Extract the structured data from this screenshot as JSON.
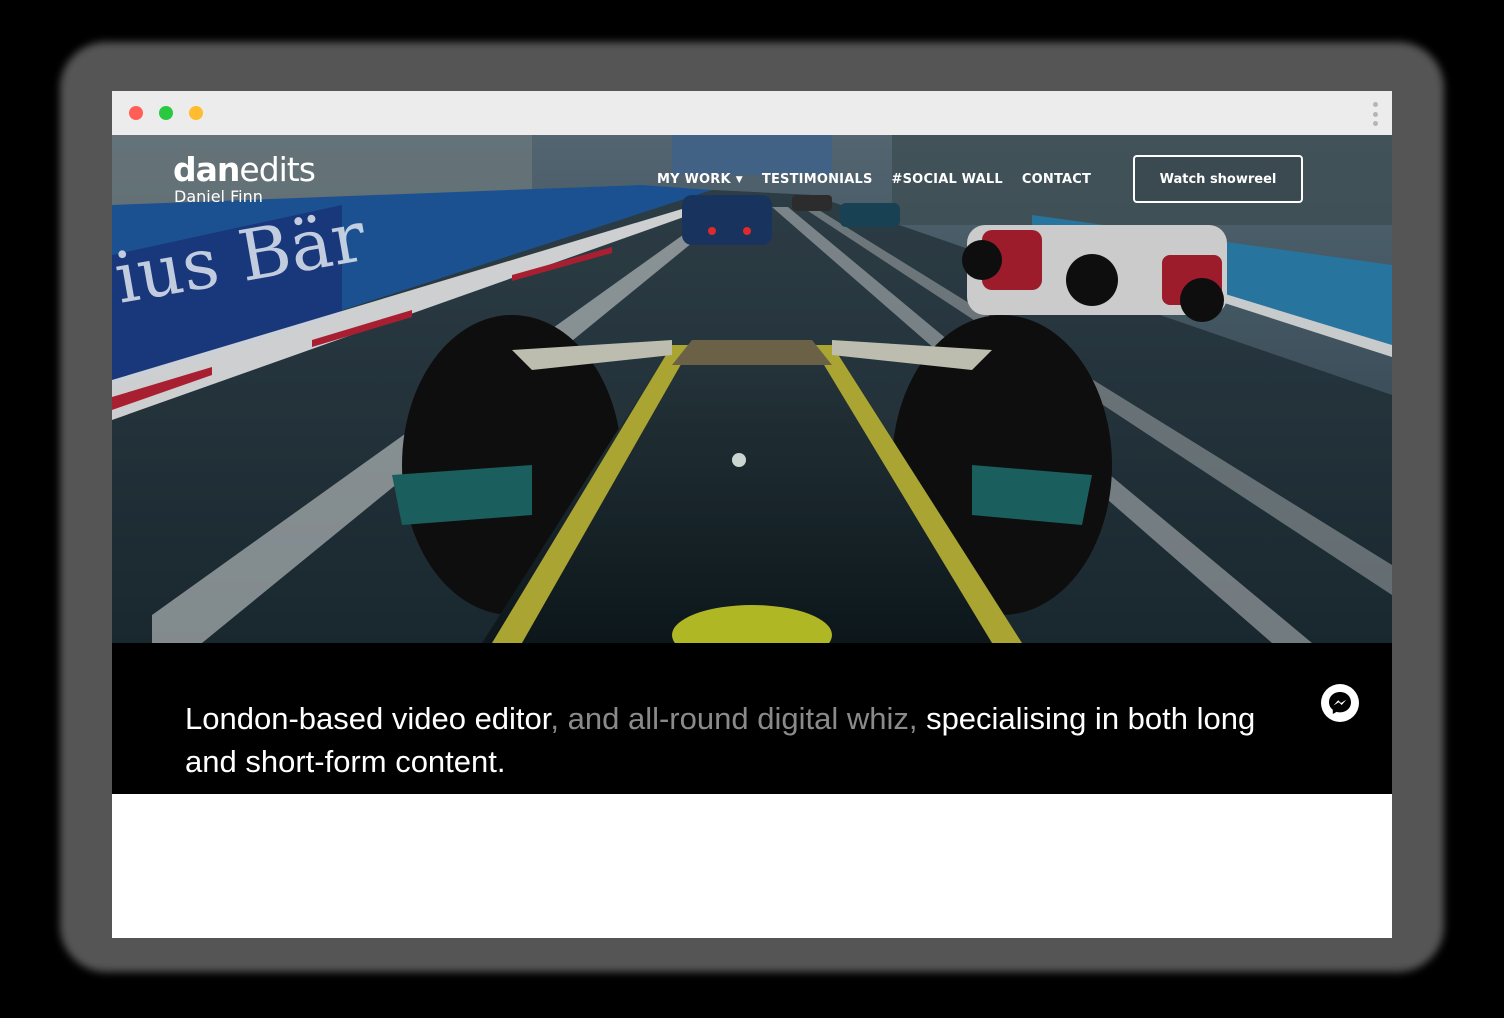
{
  "window": {
    "controls": [
      "close",
      "minimize",
      "maximize"
    ],
    "colors": {
      "close": "#ff5f57",
      "minimize": "#2ac840",
      "maximize": "#febc2e"
    },
    "menu_icon": "kebab-icon"
  },
  "hero": {
    "image": "race-car-cockpit-photo",
    "banner_text_left": "ius Bär",
    "logo": {
      "bold": "dan",
      "light": "edits",
      "subtitle": "Daniel Finn"
    },
    "nav": {
      "my_work": "MY WORK",
      "testimonials": "TESTIMONIALS",
      "social_wall": "#SOCIAL WALL",
      "contact": "CONTACT"
    },
    "cta": "Watch showreel"
  },
  "intro": {
    "part1": "London-based video editor",
    "part2": ", and all-round digital whiz, ",
    "part3": "specialising in both long and short-form content."
  },
  "chat": {
    "icon": "messenger-icon"
  }
}
